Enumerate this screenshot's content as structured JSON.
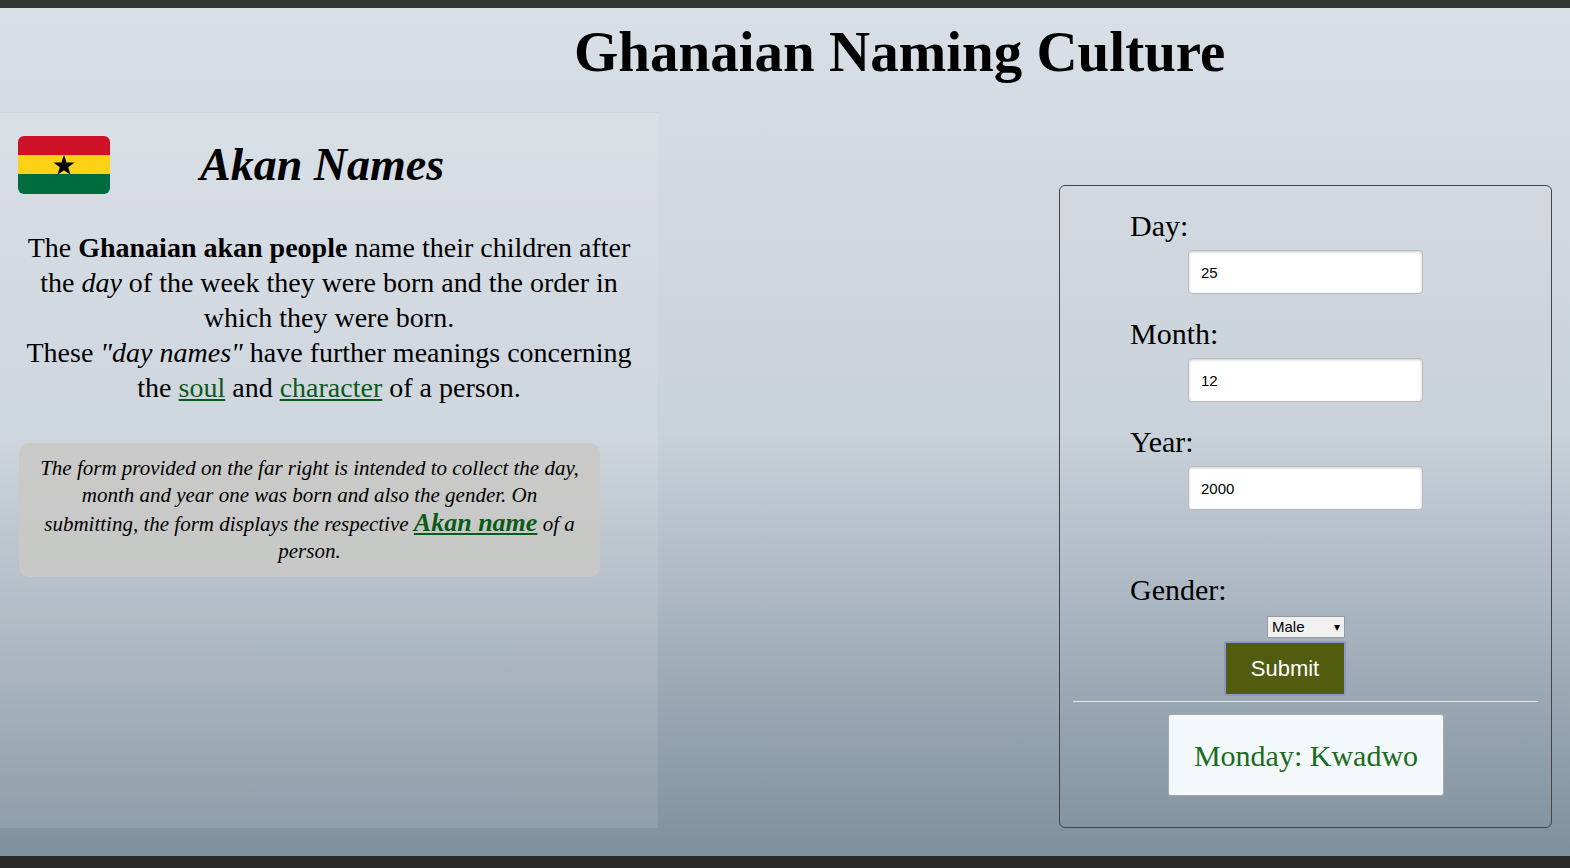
{
  "page": {
    "title": "Ghanaian Naming Culture"
  },
  "intro": {
    "heading": "Akan Names",
    "paragraphs": [
      [
        {
          "text": "The ",
          "style": "normal"
        },
        {
          "text": "Ghanaian akan people",
          "style": "bold"
        },
        {
          "text": " name their children after the ",
          "style": "normal"
        },
        {
          "text": "day",
          "style": "italic"
        },
        {
          "text": " of the week they were born and the order in which they were born.",
          "style": "normal"
        }
      ],
      [
        {
          "text": "These ",
          "style": "normal"
        },
        {
          "text": "\"day names\"",
          "style": "italic"
        },
        {
          "text": " have further meanings concerning the ",
          "style": "normal"
        },
        {
          "text": "soul",
          "style": "link"
        },
        {
          "text": " and ",
          "style": "normal"
        },
        {
          "text": "character",
          "style": "link"
        },
        {
          "text": " of a person.",
          "style": "normal"
        }
      ]
    ]
  },
  "note": [
    {
      "text": "The form provided on the far right is intended to collect the day, month and year one was born and also the gender. On submitting, the form displays the respective ",
      "style": "normal"
    },
    {
      "text": "Akan name",
      "style": "link"
    },
    {
      "text": " of a person.",
      "style": "normal"
    }
  ],
  "form": {
    "fields": [
      {
        "label": "Day:",
        "value": "25"
      },
      {
        "label": "Month:",
        "value": "12"
      },
      {
        "label": "Year:",
        "value": "2000"
      }
    ],
    "gender": {
      "label": "Gender:",
      "value": "Male",
      "arrow": "▾"
    },
    "submit": "Submit",
    "result": "Monday: Kwadwo"
  }
}
